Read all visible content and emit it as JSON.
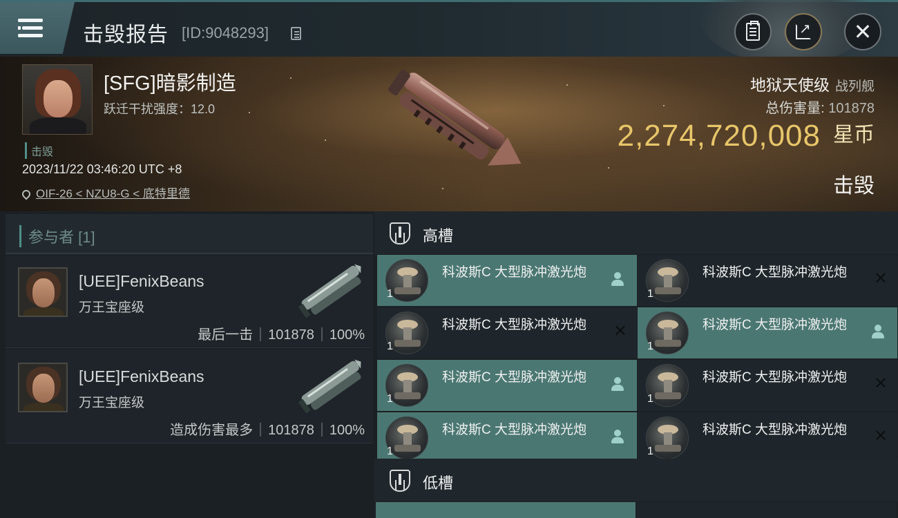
{
  "header": {
    "title": "击毁报告",
    "report_id": "[ID:9048293]"
  },
  "victim": {
    "pilot_name": "[SFG]暗影制造",
    "warp_scramble": "跃迁干扰强度：12.0",
    "status_tag": "击毁",
    "datetime": "2023/11/22 03:46:20 UTC +8",
    "location": "OIF-26 < NZU8-G < 底特里德",
    "ship_name": "地狱天使级",
    "ship_class": "战列舰",
    "damage_label": "总伤害量:",
    "damage_value": "101878",
    "isk_value": "2,274,720,008",
    "isk_unit": "星币",
    "outcome": "击毁"
  },
  "participants": {
    "header": "参与者 [1]",
    "list": [
      {
        "name": "[UEE]FenixBeans",
        "ship": "万王宝座级",
        "role": "最后一击",
        "damage": "101878",
        "percent": "100%"
      },
      {
        "name": "[UEE]FenixBeans",
        "ship": "万王宝座级",
        "role": "造成伤害最多",
        "damage": "101878",
        "percent": "100%"
      }
    ]
  },
  "slots": {
    "high_label": "高槽",
    "low_label": "低槽",
    "high_modules": [
      {
        "name": "科波斯C 大型脉冲激光炮",
        "qty": "1",
        "status": "fitted"
      },
      {
        "name": "科波斯C 大型脉冲激光炮",
        "qty": "1",
        "status": "destroyed"
      },
      {
        "name": "科波斯C 大型脉冲激光炮",
        "qty": "1",
        "status": "destroyed"
      },
      {
        "name": "科波斯C 大型脉冲激光炮",
        "qty": "1",
        "status": "fitted"
      },
      {
        "name": "科波斯C 大型脉冲激光炮",
        "qty": "1",
        "status": "fitted"
      },
      {
        "name": "科波斯C 大型脉冲激光炮",
        "qty": "1",
        "status": "destroyed"
      },
      {
        "name": "科波斯C 大型脉冲激光炮",
        "qty": "1",
        "status": "fitted"
      },
      {
        "name": "科波斯C 大型脉冲激光炮",
        "qty": "1",
        "status": "destroyed"
      }
    ]
  },
  "colors": {
    "accent": "#4f8f86",
    "isk_gold": "#e8c66a",
    "fitted_bg": "#4b7772",
    "destroyed_bg": "#1f262b"
  },
  "icons": {
    "menu": "hamburger-icon",
    "copy": "copy-icon",
    "clipboard": "clipboard-icon",
    "share": "share-icon",
    "close": "close-icon",
    "location": "map-pin-icon",
    "slot": "shield-icon",
    "fitted": "person-icon",
    "destroyed": "x-icon"
  }
}
